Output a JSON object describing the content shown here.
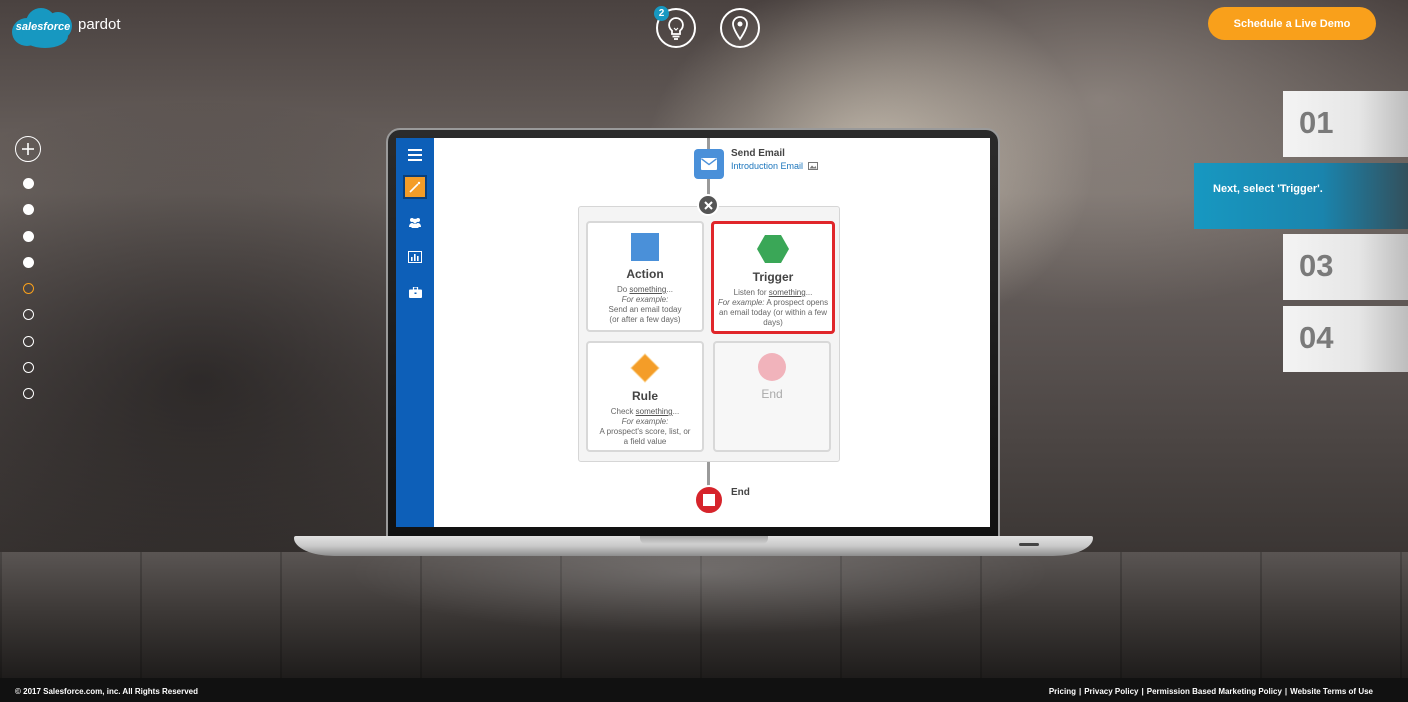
{
  "brand": {
    "cloud_label": "salesforce",
    "product": "pardot"
  },
  "header": {
    "notification_count": "2",
    "cta_label": "Schedule a Live Demo"
  },
  "steps": [
    {
      "label": "01"
    },
    {
      "label": "Next, select 'Trigger'."
    },
    {
      "label": "03"
    },
    {
      "label": "04"
    }
  ],
  "app": {
    "send_email_title": "Send Email",
    "send_email_sub": "Introduction Email",
    "cards": {
      "action": {
        "title": "Action",
        "line1_pre": "Do ",
        "line1_u": "something",
        "line1_post": "...",
        "example": "For example:",
        "desc": "Send an email today (or after a few days)"
      },
      "trigger": {
        "title": "Trigger",
        "line1_pre": "Listen for ",
        "line1_u": "something",
        "line1_post": "...",
        "example": "For example:",
        "desc": "A prospect opens an email today (or within a few days)"
      },
      "rule": {
        "title": "Rule",
        "line1_pre": "Check ",
        "line1_u": "something",
        "line1_post": "...",
        "example": "For example:",
        "desc": "A prospect's score, list, or a field value"
      },
      "end": {
        "title": "End"
      }
    },
    "end_label": "End"
  },
  "colors": {
    "accent_orange": "#f9a01b",
    "brand_blue": "#1798c1",
    "sidebar_blue": "#0d5fb8",
    "action_blue": "#4a90d9",
    "trigger_green": "#3aa757",
    "rule_orange": "#f49d28",
    "end_pink": "#f1b3bb",
    "selected_red": "#e0262a"
  },
  "footer": {
    "copyright": "© 2017 Salesforce.com, inc. All Rights Reserved",
    "links": [
      "Pricing",
      "Privacy Policy",
      "Permission Based Marketing Policy",
      "Website Terms of Use"
    ]
  }
}
